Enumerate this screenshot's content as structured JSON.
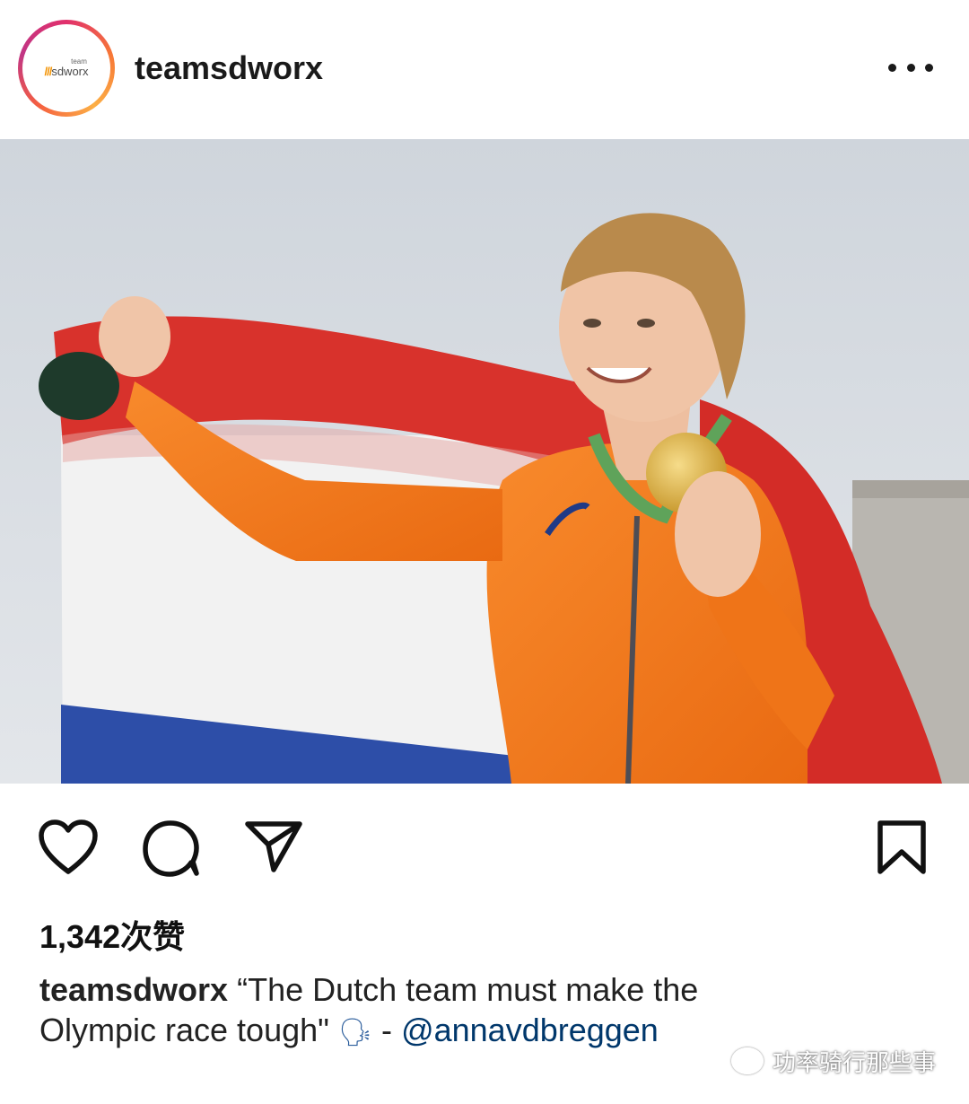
{
  "post": {
    "header": {
      "avatar_small": "team",
      "avatar_brand": "sdworx",
      "username": "teamsdworx",
      "more_icon": "more-horizontal-icon"
    },
    "photo": {
      "colors": {
        "sky": "#d9dee4",
        "flag_red": "#d5302b",
        "flag_white": "#f4f4f4",
        "flag_blue": "#2b4da8",
        "jacket": "#f47a1f",
        "medal": "#e2b94d"
      }
    },
    "actions": {
      "like_icon": "heart-icon",
      "comment_icon": "comment-icon",
      "share_icon": "send-icon",
      "save_icon": "bookmark-icon"
    },
    "likes_label": "1,342次赞",
    "caption": {
      "username": "teamsdworx",
      "text_part1": "“The Dutch team must make the",
      "text_part2": "Olympic race tough\"",
      "emoji": "🗣",
      "dash": "-",
      "mention": "@annavdbreggen"
    },
    "watermark": "功率骑行那些事"
  }
}
